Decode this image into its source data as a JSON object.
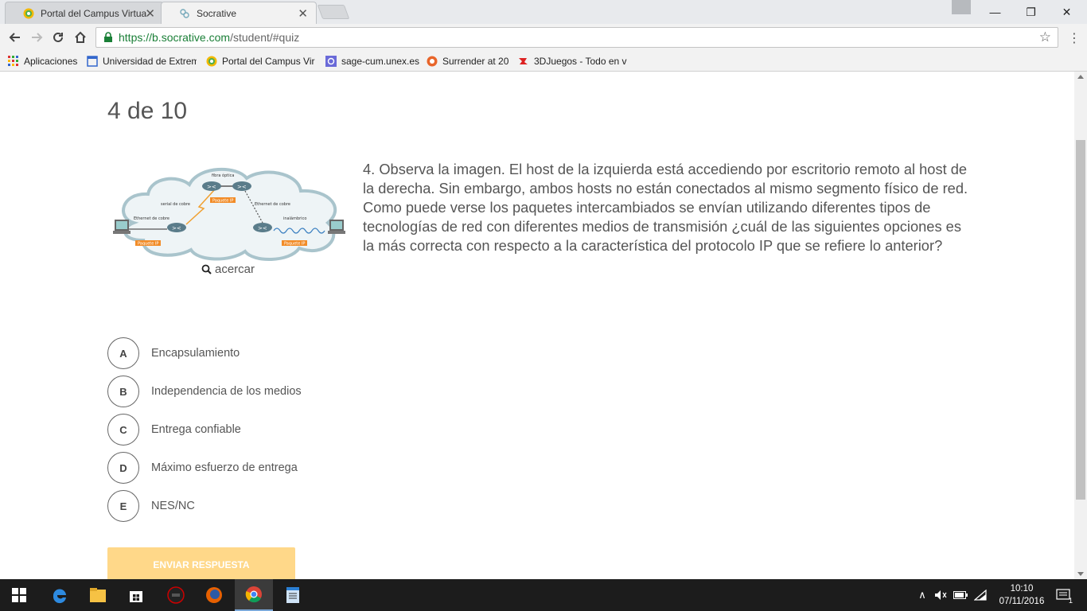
{
  "browser": {
    "tabs": [
      {
        "title": "Portal del Campus Virtua",
        "active": false
      },
      {
        "title": "Socrative",
        "active": true
      }
    ],
    "window_controls": {
      "minimize": "—",
      "maximize": "❐",
      "close": "✕"
    },
    "address": {
      "scheme_host": "https://b.socrative.com",
      "path": "/student/#quiz"
    },
    "bookmarks": [
      {
        "label": "Aplicaciones",
        "icon": "apps-icon"
      },
      {
        "label": "Universidad de Extrem",
        "icon": "page-icon"
      },
      {
        "label": "Portal del Campus Vir",
        "icon": "campus-icon"
      },
      {
        "label": "sage-cum.unex.es",
        "icon": "sage-icon"
      },
      {
        "label": "Surrender at 20",
        "icon": "surrender-icon"
      },
      {
        "label": "3DJuegos - Todo en v",
        "icon": "3djuegos-icon"
      }
    ]
  },
  "quiz": {
    "counter": "4 de 10",
    "zoom_label": "acercar",
    "question": "4. Observa la imagen. El host de la izquierda está accediendo por escritorio remoto al host de la derecha. Sin embargo, ambos hosts no están conectados al mismo segmento físico de red. Como puede verse los paquetes intercambiados se envían utilizando diferentes tipos de tecnologías de red con diferentes medios de transmisión ¿cuál de las siguientes opciones es la más correcta con respecto a la característica del protocolo IP que se refiere lo anterior?",
    "image_labels": {
      "fiber": "fibra óptica",
      "serial": "serial de cobre",
      "ethernet_left": "Ethernet de cobre",
      "ethernet_right": "Ethernet de cobre",
      "wireless": "inalámbrico",
      "packet": "Paquete IP"
    },
    "answers": [
      {
        "letter": "A",
        "text": "Encapsulamiento"
      },
      {
        "letter": "B",
        "text": "Independencia de los medios"
      },
      {
        "letter": "C",
        "text": "Entrega confiable"
      },
      {
        "letter": "D",
        "text": "Máximo esfuerzo de entrega"
      },
      {
        "letter": "E",
        "text": "NES/NC"
      }
    ],
    "submit_label": "ENVIAR RESPUESTA"
  },
  "taskbar": {
    "time": "10:10",
    "date": "07/11/2016",
    "notifications": "1"
  },
  "colors": {
    "submit_bg": "#ffd889",
    "text": "#555555",
    "taskbar": "#1c1c1c"
  }
}
